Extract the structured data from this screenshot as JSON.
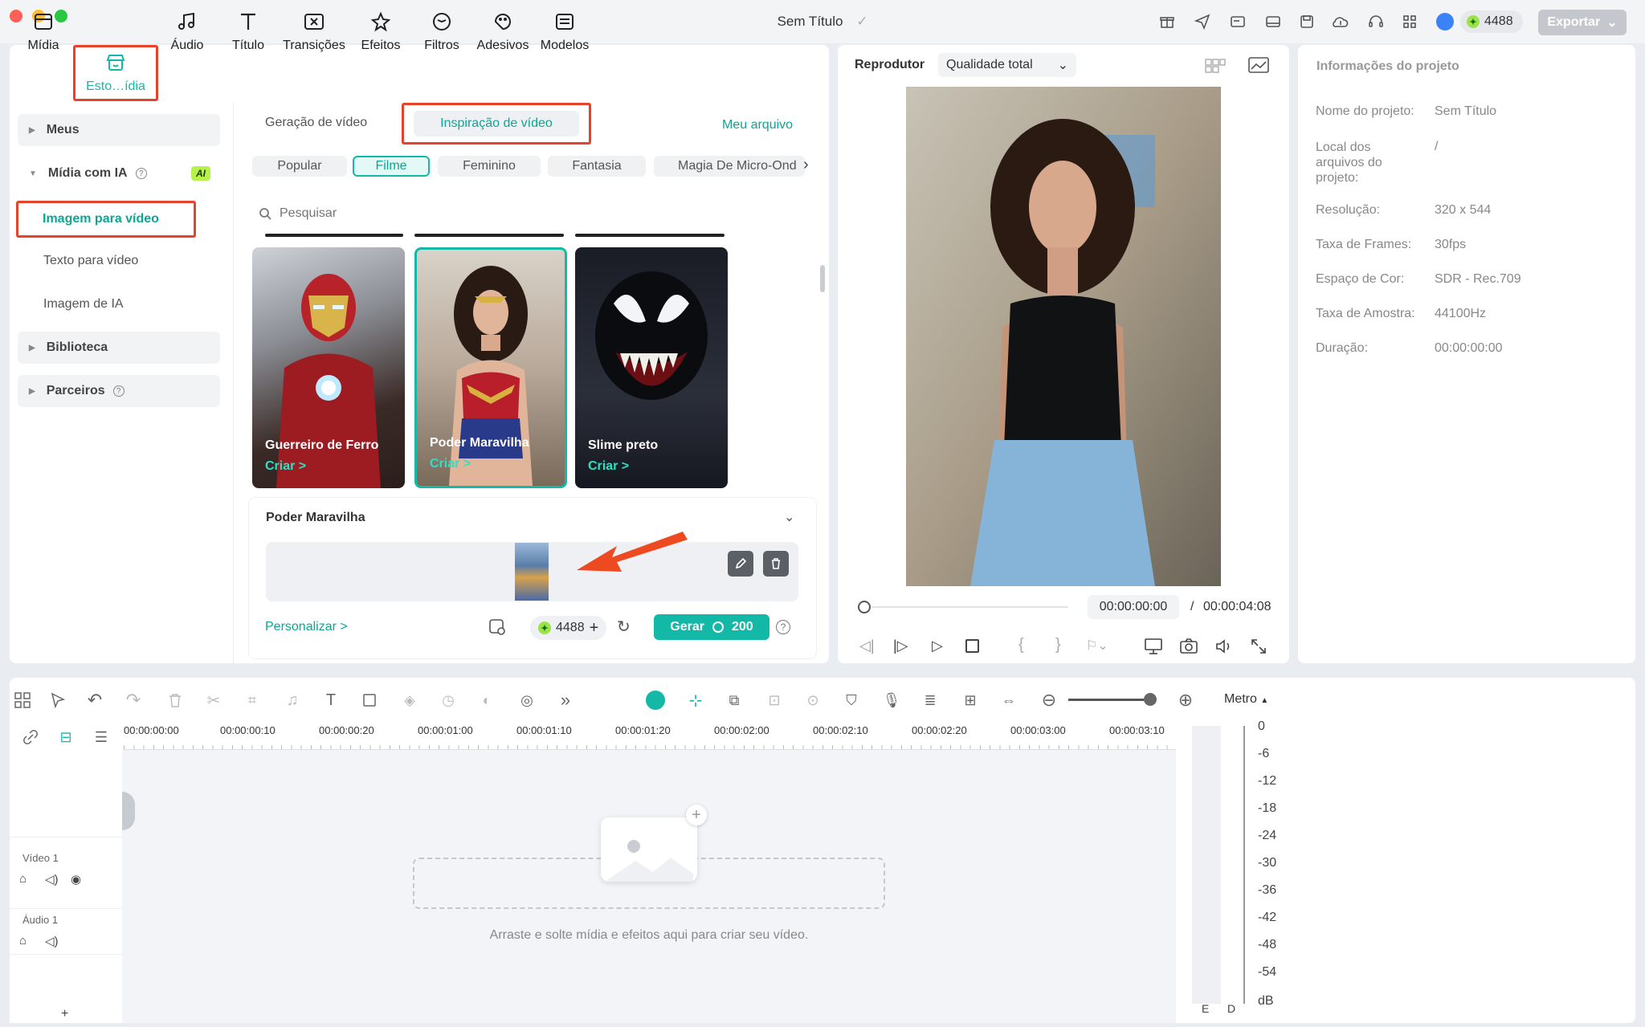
{
  "window": {
    "title": "Sem Título",
    "credits": "4488",
    "export_label": "Exportar"
  },
  "colors": {
    "accent": "#14b8a6",
    "highlight": "#e8432a",
    "panel": "#ffffff",
    "background": "#e9ecf0"
  },
  "top_tabs": [
    {
      "label": "Mídia",
      "icon": "media-icon"
    },
    {
      "label": "Esto…ídia",
      "icon": "store-icon"
    },
    {
      "label": "Áudio",
      "icon": "music-note-icon"
    },
    {
      "label": "Título",
      "icon": "text-t-icon"
    },
    {
      "label": "Transições",
      "icon": "transition-icon"
    },
    {
      "label": "Efeitos",
      "icon": "effects-icon"
    },
    {
      "label": "Filtros",
      "icon": "filter-icon"
    },
    {
      "label": "Adesivos",
      "icon": "sticker-icon"
    },
    {
      "label": "Modelos",
      "icon": "templates-icon"
    }
  ],
  "sidebar": {
    "meus": "Meus",
    "midia_ia": "Mídia com IA",
    "ai_badge": "AI",
    "items": [
      "Imagem para vídeo",
      "Texto para vídeo",
      "Imagem de IA"
    ],
    "biblioteca": "Biblioteca",
    "parceiros": "Parceiros"
  },
  "library": {
    "subtabs": [
      "Geração de vídeo",
      "Inspiração de vídeo"
    ],
    "my_file": "Meu arquivo",
    "chips": [
      "Popular",
      "Filme",
      "Feminino",
      "Fantasia",
      "Magia De Micro-Ond"
    ],
    "search_placeholder": "Pesquisar",
    "cards": [
      {
        "name": "Guerreiro de Ferro",
        "cta": "Criar >"
      },
      {
        "name": "Poder Maravilha",
        "cta": "Criar >"
      },
      {
        "name": "Slime preto",
        "cta": "Criar >"
      }
    ],
    "detail_title": "Poder Maravilha",
    "customize": "Personalizar >",
    "credits": "4488",
    "generate_label": "Gerar",
    "generate_cost": "200"
  },
  "preview": {
    "label": "Reprodutor",
    "quality": "Qualidade total",
    "current_time": "00:00:00:00",
    "separator": "/",
    "total_time": "00:00:04:08"
  },
  "info": {
    "title": "Informações do projeto",
    "rows": [
      {
        "label": "Nome do projeto:",
        "value": "Sem Título"
      },
      {
        "label": "Local dos arquivos do projeto:",
        "value": "/"
      },
      {
        "label": "Resolução:",
        "value": "320 x 544"
      },
      {
        "label": "Taxa de Frames:",
        "value": "30fps"
      },
      {
        "label": "Espaço de Cor:",
        "value": "SDR - Rec.709"
      },
      {
        "label": "Taxa de Amostra:",
        "value": "44100Hz"
      },
      {
        "label": "Duração:",
        "value": "00:00:00:00"
      }
    ]
  },
  "timeline": {
    "meter_label": "Metro",
    "ticks": [
      "00:00:00:00",
      "00:00:00:10",
      "00:00:00:20",
      "00:00:01:00",
      "00:00:01:10",
      "00:00:01:20",
      "00:00:02:00",
      "00:00:02:10",
      "00:00:02:20",
      "00:00:03:00",
      "00:00:03:10"
    ],
    "tracks": {
      "video": "Vídeo 1",
      "audio": "Áudio 1"
    },
    "drop_hint": "Arraste e solte mídia e efeitos aqui para criar seu vídeo.",
    "db_scale": [
      "0",
      "-6",
      "-12",
      "-18",
      "-24",
      "-30",
      "-36",
      "-42",
      "-48",
      "-54",
      "dB"
    ],
    "channels": [
      "E",
      "D"
    ],
    "add": "+"
  }
}
